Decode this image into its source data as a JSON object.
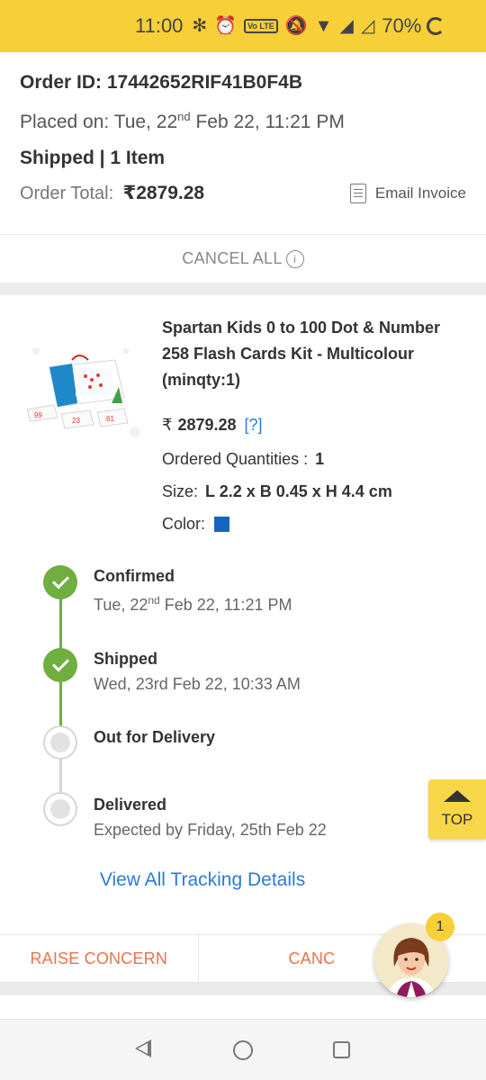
{
  "status_bar": {
    "time": "11:00",
    "network": "Vo LTE",
    "battery": "70%"
  },
  "order": {
    "id_label": "Order ID: 17442652RIF41B0F4B",
    "placed_prefix": "Placed on: Tue, 22",
    "placed_sup": "nd",
    "placed_suffix": " Feb 22, 11:21 PM",
    "status_line": "Shipped | 1 Item",
    "total_label": "Order Total:",
    "total_amount": "₹2879.28",
    "invoice_label": "Email Invoice",
    "cancel_all_label": "CANCEL ALL"
  },
  "product": {
    "title": "Spartan Kids 0 to 100 Dot & Number 258 Flash Cards Kit - Multicolour (minqty:1)",
    "currency": "₹",
    "price": "2879.28",
    "price_help": "[?]",
    "qty_label": "Ordered Quantities :",
    "qty_value": "1",
    "size_label": "Size:",
    "size_value": "L 2.2 x B 0.45 x H 4.4 cm",
    "color_label": "Color:",
    "color_hex": "#1565c0"
  },
  "timeline": [
    {
      "title": "Confirmed",
      "sub_prefix": "Tue, 22",
      "sub_sup": "nd",
      "sub_suffix": " Feb 22, 11:21 PM",
      "state": "done"
    },
    {
      "title": "Shipped",
      "sub": "Wed, 23rd Feb 22, 10:33 AM",
      "state": "done"
    },
    {
      "title": "Out for Delivery",
      "state": "pending"
    },
    {
      "title": "Delivered",
      "sub": "Expected by Friday, 25th Feb 22",
      "state": "pending"
    }
  ],
  "tracking_link": "View All Tracking Details",
  "top_button": "TOP",
  "actions": {
    "raise_concern": "RAISE CONCERN",
    "cancel": "CANC"
  },
  "assistant_badge": "1",
  "colors": {
    "accent": "#f7cf39",
    "success": "#6fae3f",
    "link": "#2b7bd8",
    "action": "#e8734a"
  }
}
